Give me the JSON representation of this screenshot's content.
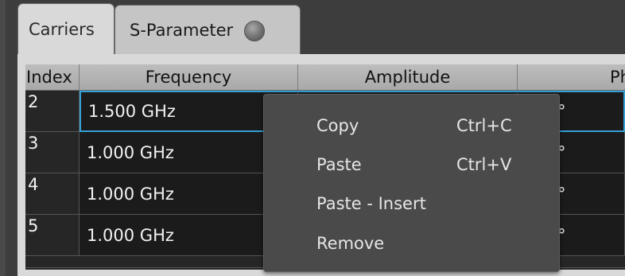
{
  "tabs": [
    {
      "label": "Carriers"
    },
    {
      "label": "S-Parameter"
    }
  ],
  "table": {
    "columns": [
      "Index",
      "Frequency",
      "Amplitude",
      "Pha"
    ],
    "rows": [
      {
        "index": "2",
        "frequency": "1.500 GHz",
        "phase": "°"
      },
      {
        "index": "3",
        "frequency": "1.000 GHz",
        "phase": "°"
      },
      {
        "index": "4",
        "frequency": "1.000 GHz",
        "phase": "°"
      },
      {
        "index": "5",
        "frequency": "1.000 GHz",
        "phase": "°"
      }
    ],
    "selected_row_index": "2"
  },
  "context_menu": {
    "items": [
      {
        "label": "Copy",
        "shortcut": "Ctrl+C"
      },
      {
        "label": "Paste",
        "shortcut": "Ctrl+V"
      },
      {
        "label": "Paste - Insert",
        "shortcut": ""
      },
      {
        "label": "Remove",
        "shortcut": ""
      }
    ]
  },
  "colors": {
    "selection": "#34a0d6",
    "grid_background": "#1b1b1b",
    "menu_background": "#4a4a4a"
  },
  "icons": [
    "status-led-icon"
  ]
}
